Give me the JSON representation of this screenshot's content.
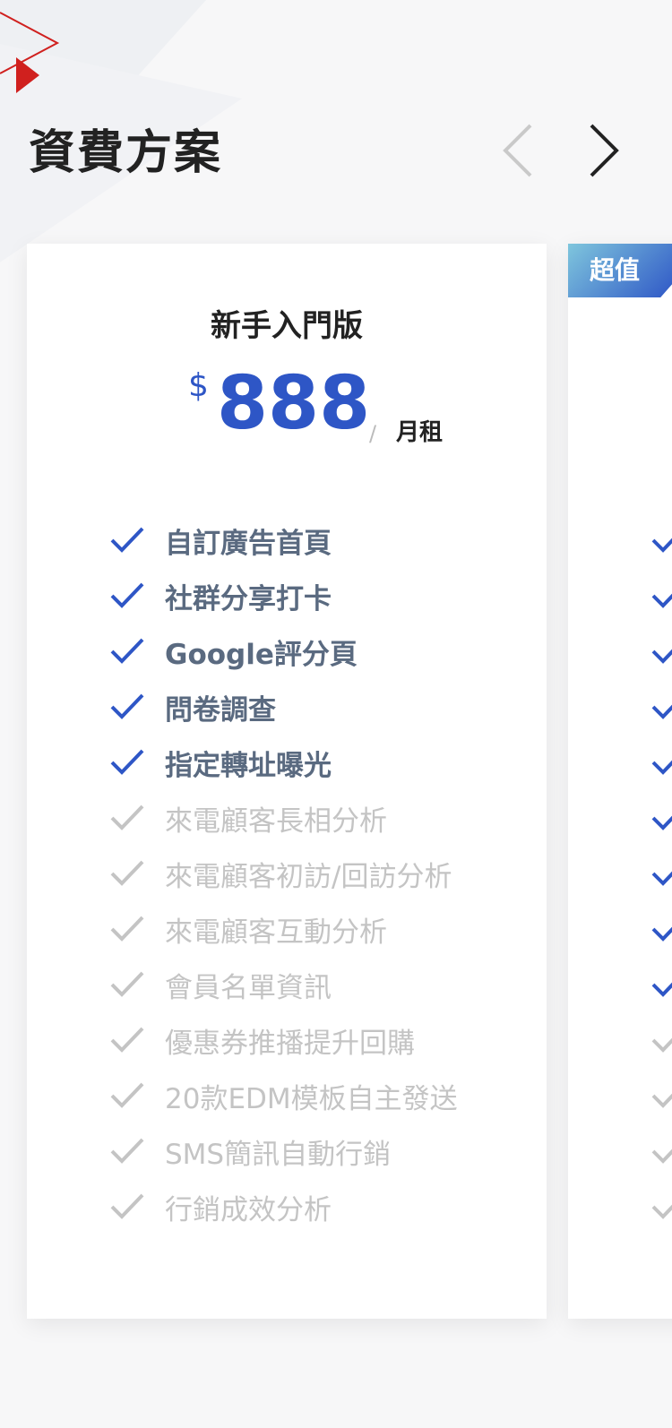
{
  "section": {
    "title": "資費方案"
  },
  "nav": {
    "prev_icon": "chevron-left-icon",
    "next_icon": "chevron-right-icon"
  },
  "plans": [
    {
      "name": "新手入門版",
      "currency": "$",
      "price": "888",
      "slash": "∕",
      "unit": "月租",
      "features": [
        {
          "label": "自訂廣告首頁",
          "included": true
        },
        {
          "label": "社群分享打卡",
          "included": true
        },
        {
          "label": "Google評分頁",
          "included": true
        },
        {
          "label": "問卷調查",
          "included": true
        },
        {
          "label": "指定轉址曝光",
          "included": true
        },
        {
          "label": "來電顧客長相分析",
          "included": false
        },
        {
          "label": "來電顧客初訪/回訪分析",
          "included": false
        },
        {
          "label": "來電顧客互動分析",
          "included": false
        },
        {
          "label": "會員名單資訊",
          "included": false
        },
        {
          "label": "優惠券推播提升回購",
          "included": false
        },
        {
          "label": "20款EDM模板自主發送",
          "included": false
        },
        {
          "label": "SMS簡訊自動行銷",
          "included": false
        },
        {
          "label": "行銷成效分析",
          "included": false
        }
      ]
    },
    {
      "badge": "超值",
      "features_included": [
        true,
        true,
        true,
        true,
        true,
        true,
        true,
        true,
        true,
        false,
        false,
        false,
        false
      ]
    }
  ],
  "colors": {
    "accent": "#2e56c6",
    "included_text": "#5a6a80",
    "excluded": "#c4c4c4",
    "badge_gradient_start": "#7fc6dd",
    "badge_gradient_end": "#2e56c6",
    "deco_red": "#d0201e"
  }
}
